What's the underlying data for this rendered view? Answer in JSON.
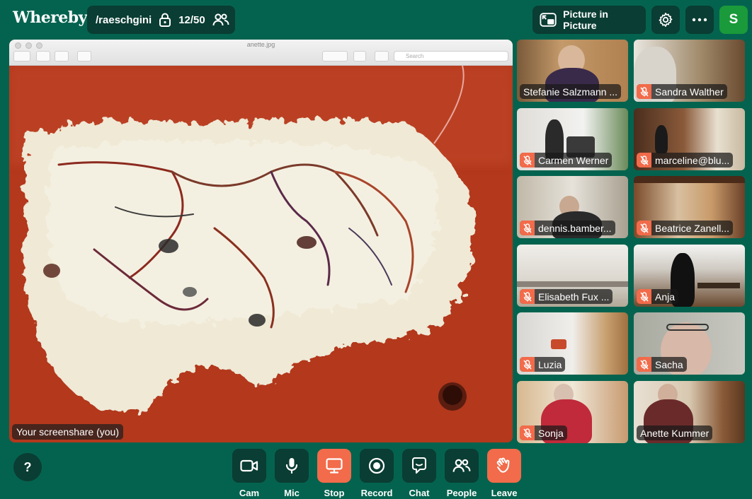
{
  "app": {
    "logo": "Whereby"
  },
  "room": {
    "name": "/raeschgini",
    "count": "12/50"
  },
  "header": {
    "pip_label": "Picture in Picture",
    "avatar_initial": "S"
  },
  "screenshare": {
    "window_title": "anette.jpg",
    "search_placeholder": "Search",
    "label": "Your screenshare (you)"
  },
  "participants": [
    {
      "name": "Stefanie Salzmann ...",
      "muted": false
    },
    {
      "name": "Sandra Walther",
      "muted": true
    },
    {
      "name": "Carmen Werner",
      "muted": true
    },
    {
      "name": "marceline@blu...",
      "muted": true
    },
    {
      "name": "dennis.bamber...",
      "muted": true
    },
    {
      "name": "Beatrice Zanell...",
      "muted": true
    },
    {
      "name": "Elisabeth Fux ...",
      "muted": true
    },
    {
      "name": "Anja",
      "muted": true
    },
    {
      "name": "Luzia",
      "muted": true
    },
    {
      "name": "Sacha",
      "muted": true
    },
    {
      "name": "Sonja",
      "muted": true
    },
    {
      "name": "Anette Kummer",
      "muted": false
    }
  ],
  "controls": {
    "help": "?",
    "cam": "Cam",
    "mic": "Mic",
    "stop": "Stop",
    "record": "Record",
    "chat": "Chat",
    "people": "People",
    "leave": "Leave"
  },
  "colors": {
    "background": "#04634f",
    "button": "#0a3d33",
    "accent": "#f26b4a",
    "avatar": "#1a9a3a"
  }
}
